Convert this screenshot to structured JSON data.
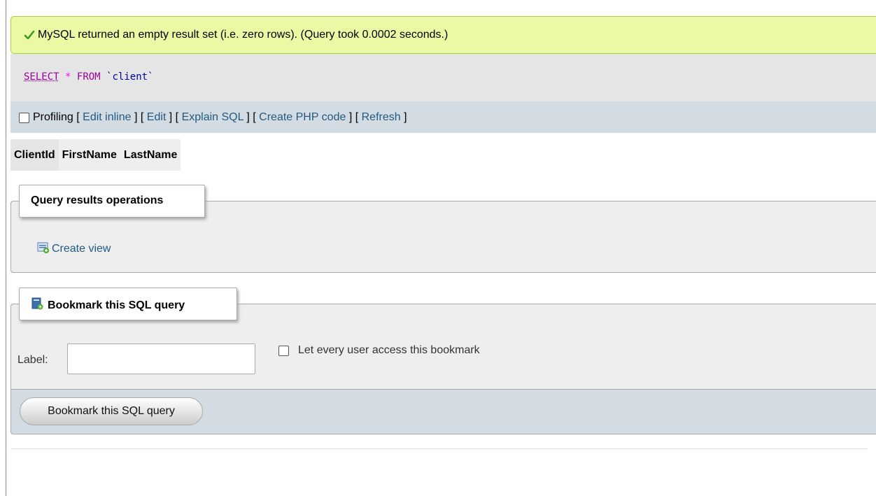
{
  "success": {
    "icon": "checkmark-icon",
    "message": "MySQL returned an empty result set (i.e. zero rows). (Query took 0.0002 seconds.)",
    "color": "#ebf8a4"
  },
  "sql": {
    "keyword_select": "SELECT",
    "star": "*",
    "keyword_from": "FROM",
    "table": "`client`"
  },
  "tools": {
    "profiling_label": "Profiling",
    "links": [
      "Edit inline",
      "Edit",
      "Explain SQL",
      "Create PHP code",
      "Refresh"
    ]
  },
  "results": {
    "columns": [
      "ClientId",
      "FirstName",
      "LastName"
    ]
  },
  "operations": {
    "legend": "Query results operations",
    "create_view": "Create view"
  },
  "bookmark": {
    "legend": "Bookmark this SQL query",
    "label_text": "Label:",
    "label_value": "",
    "share_label": "Let every user access this bookmark",
    "submit_label": "Bookmark this SQL query"
  },
  "colors": {
    "link": "#235a81",
    "toolbar_bg": "#d3dce3",
    "fieldset_bg": "#eeeeee"
  }
}
